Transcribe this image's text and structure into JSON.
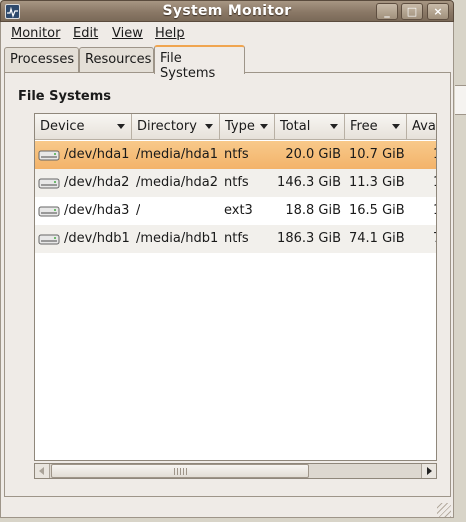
{
  "window": {
    "title": "System Monitor",
    "controls": {
      "minimize": "_",
      "maximize": "□",
      "close": "×"
    }
  },
  "menubar": {
    "items": [
      {
        "label": "Monitor",
        "icon": ""
      },
      {
        "label": "Edit"
      },
      {
        "label": "View"
      },
      {
        "label": "Help"
      }
    ]
  },
  "tabs": [
    {
      "label": "Processes",
      "active": false
    },
    {
      "label": "Resources",
      "active": false
    },
    {
      "label": "File Systems",
      "active": true
    }
  ],
  "section": {
    "title": "File Systems"
  },
  "table": {
    "columns": [
      "Device",
      "Directory",
      "Type",
      "Total",
      "Free",
      "Ava"
    ],
    "rows": [
      {
        "device": "/dev/hda1",
        "directory": "/media/hda1",
        "type": "ntfs",
        "total": "20.0 GiB",
        "free": "10.7 GiB",
        "avail": "1",
        "selected": true
      },
      {
        "device": "/dev/hda2",
        "directory": "/media/hda2",
        "type": "ntfs",
        "total": "146.3 GiB",
        "free": "11.3 GiB",
        "avail": "1",
        "selected": false
      },
      {
        "device": "/dev/hda3",
        "directory": "/",
        "type": "ext3",
        "total": "18.8 GiB",
        "free": "16.5 GiB",
        "avail": "1",
        "selected": false
      },
      {
        "device": "/dev/hdb1",
        "directory": "/media/hdb1",
        "type": "ntfs",
        "total": "186.3 GiB",
        "free": "74.1 GiB",
        "avail": "7",
        "selected": false
      }
    ],
    "icon": "hard-disk-icon"
  },
  "colors": {
    "selection": "#f3b36a",
    "accent_tab": "#f0a550",
    "titlebar": "#8a7866"
  }
}
